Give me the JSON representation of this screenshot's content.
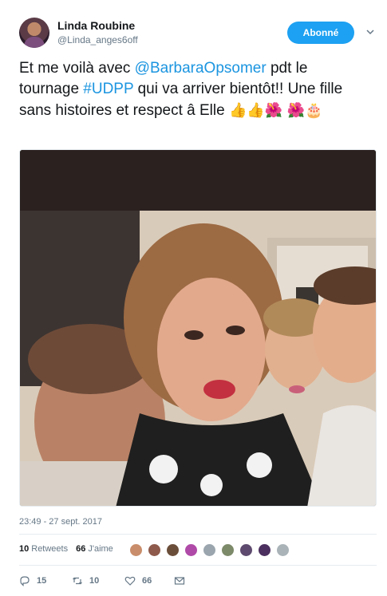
{
  "author": {
    "name": "Linda Roubine",
    "handle": "@Linda_anges6off"
  },
  "follow_button": {
    "label": "Abonné"
  },
  "tweet": {
    "text_before": "Et me voilà avec ",
    "mention": "@BarbaraOpsomer",
    "text_middle": " pdt le tournage ",
    "hashtag": "#UDPP",
    "text_after": " qui va arriver bientôt!! Une fille sans histoires et respect â Elle ",
    "emojis": [
      "👍",
      "👍",
      "🌺",
      "🌺",
      "🎂"
    ]
  },
  "timestamp": "23:49 - 27 sept. 2017",
  "stats": {
    "retweets_count": "10",
    "retweets_label": "Retweets",
    "likes_count": "66",
    "likes_label": "J'aime"
  },
  "liker_avatar_colors": [
    "#c98d6b",
    "#8e5a4b",
    "#6b4e3a",
    "#b04aa8",
    "#9aa5ad",
    "#7d8a6a",
    "#5e4a6e",
    "#4b2f5e",
    "#a9b3b8"
  ],
  "actions": {
    "reply_count": "15",
    "retweet_count": "10",
    "like_count": "66"
  },
  "colors": {
    "accent": "#1da1f2",
    "link": "#1b95e0",
    "secondary_text": "#657786"
  }
}
